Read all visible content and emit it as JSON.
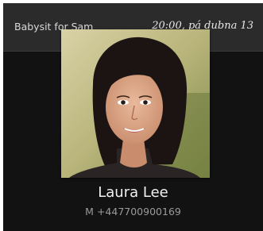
{
  "notification": {
    "event_title": "Babysit for Sam",
    "datetime": "20:00, pá dubna 13"
  },
  "contact": {
    "name": "Laura Lee",
    "phone_label": "M",
    "phone_number": "+447700900169",
    "photo_icon": "contact-photo"
  },
  "colors": {
    "background": "#121212",
    "topbar": "#2b2b2b",
    "name_text": "#f2f2f2",
    "phone_text": "#9a9a9a"
  }
}
